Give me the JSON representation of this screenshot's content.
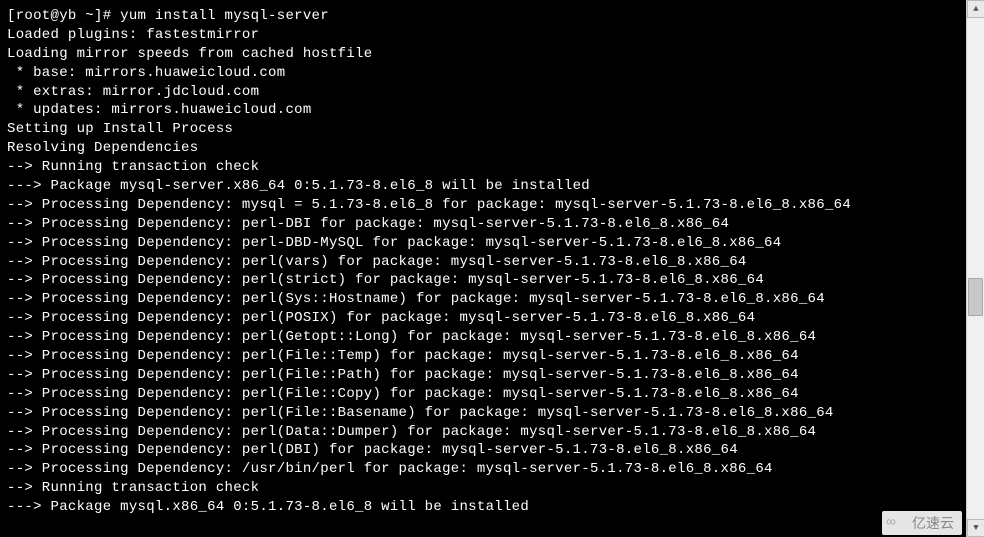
{
  "terminal": {
    "lines": [
      "[root@yb ~]# yum install mysql-server",
      "Loaded plugins: fastestmirror",
      "Loading mirror speeds from cached hostfile",
      " * base: mirrors.huaweicloud.com",
      " * extras: mirror.jdcloud.com",
      " * updates: mirrors.huaweicloud.com",
      "Setting up Install Process",
      "Resolving Dependencies",
      "--> Running transaction check",
      "---> Package mysql-server.x86_64 0:5.1.73-8.el6_8 will be installed",
      "--> Processing Dependency: mysql = 5.1.73-8.el6_8 for package: mysql-server-5.1.73-8.el6_8.x86_64",
      "--> Processing Dependency: perl-DBI for package: mysql-server-5.1.73-8.el6_8.x86_64",
      "--> Processing Dependency: perl-DBD-MySQL for package: mysql-server-5.1.73-8.el6_8.x86_64",
      "--> Processing Dependency: perl(vars) for package: mysql-server-5.1.73-8.el6_8.x86_64",
      "--> Processing Dependency: perl(strict) for package: mysql-server-5.1.73-8.el6_8.x86_64",
      "--> Processing Dependency: perl(Sys::Hostname) for package: mysql-server-5.1.73-8.el6_8.x86_64",
      "--> Processing Dependency: perl(POSIX) for package: mysql-server-5.1.73-8.el6_8.x86_64",
      "--> Processing Dependency: perl(Getopt::Long) for package: mysql-server-5.1.73-8.el6_8.x86_64",
      "--> Processing Dependency: perl(File::Temp) for package: mysql-server-5.1.73-8.el6_8.x86_64",
      "--> Processing Dependency: perl(File::Path) for package: mysql-server-5.1.73-8.el6_8.x86_64",
      "--> Processing Dependency: perl(File::Copy) for package: mysql-server-5.1.73-8.el6_8.x86_64",
      "--> Processing Dependency: perl(File::Basename) for package: mysql-server-5.1.73-8.el6_8.x86_64",
      "--> Processing Dependency: perl(Data::Dumper) for package: mysql-server-5.1.73-8.el6_8.x86_64",
      "--> Processing Dependency: perl(DBI) for package: mysql-server-5.1.73-8.el6_8.x86_64",
      "--> Processing Dependency: /usr/bin/perl for package: mysql-server-5.1.73-8.el6_8.x86_64",
      "--> Running transaction check",
      "---> Package mysql.x86_64 0:5.1.73-8.el6_8 will be installed"
    ]
  },
  "scrollbar": {
    "up_glyph": "▲",
    "down_glyph": "▼"
  },
  "watermark": {
    "text": "亿速云",
    "icon": "∞"
  }
}
